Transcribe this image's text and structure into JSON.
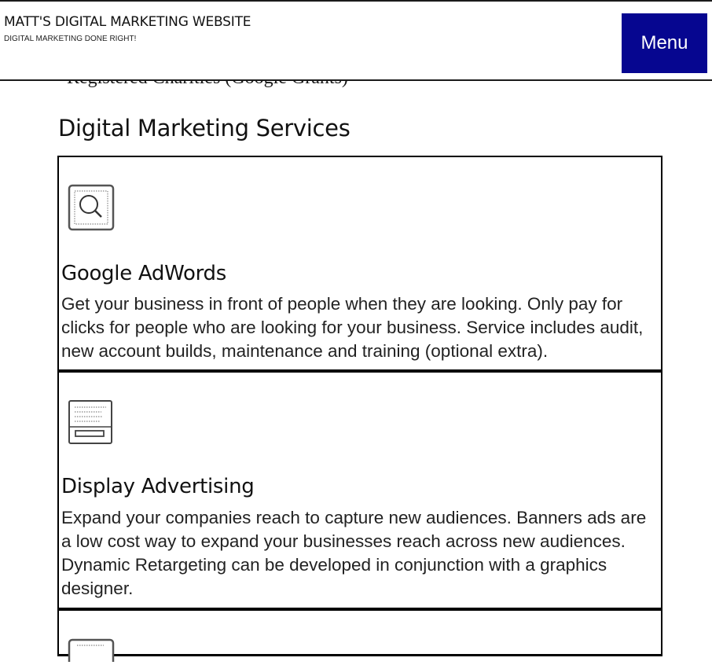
{
  "header": {
    "site_title": "MATT'S DIGITAL MARKETING WEBSITE",
    "tagline": "DIGITAL MARKETING DONE RIGHT!",
    "menu_label": "Menu"
  },
  "partial_text": "Registered Charities (Google Grants)",
  "section": {
    "heading": "Digital Marketing Services"
  },
  "services": [
    {
      "icon": "search-icon",
      "title": "Google AdWords",
      "description": "Get your business in front of people when they are looking. Only pay for clicks for people who are looking for your business. Service includes audit, new account builds, maintenance and training (optional extra)."
    },
    {
      "icon": "display-ad-icon",
      "title": "Display Advertising",
      "description": "Expand your companies reach to capture new audiences. Banners ads are a low cost way to expand your businesses reach across new audiences. Dynamic Retargeting can be developed in conjunction with a graphics designer."
    },
    {
      "icon": "service-icon"
    }
  ]
}
